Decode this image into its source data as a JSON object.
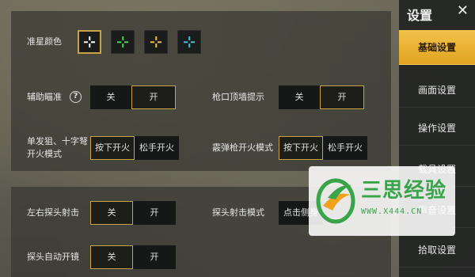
{
  "sidebar": {
    "title": "设置",
    "items": [
      {
        "label": "基础设置",
        "active": true
      },
      {
        "label": "画面设置",
        "active": false
      },
      {
        "label": "操作设置",
        "active": false
      },
      {
        "label": "载具设置",
        "active": false
      },
      {
        "label": "声音设置",
        "active": false
      },
      {
        "label": "拾取设置",
        "active": false
      }
    ]
  },
  "settings": {
    "crosshair_color": {
      "label": "准星颜色",
      "options": [
        {
          "color": "#ffffff",
          "selected": true
        },
        {
          "color": "#3fdc4b",
          "selected": false
        },
        {
          "color": "#f0c23a",
          "selected": false
        },
        {
          "color": "#3cc6d8",
          "selected": false
        }
      ]
    },
    "aim_assist": {
      "label": "辅助瞄准",
      "off": "关",
      "on": "开",
      "selected": "on"
    },
    "muzzle_wall_hint": {
      "label": "枪口顶墙提示",
      "off": "关",
      "on": "开",
      "selected": "on"
    },
    "single_shot_fire_mode": {
      "label_line1": "单发狙、十字弩",
      "label_line2": "开火模式",
      "press": "按下开火",
      "release": "松手开火",
      "selected": "press"
    },
    "shotgun_fire_mode": {
      "label": "霰弹枪开火模式",
      "press": "按下开火",
      "release": "松手开火",
      "selected": "press"
    },
    "lean_fire": {
      "label": "左右探头射击",
      "off": "关",
      "on": "开",
      "selected": "off"
    },
    "lean_fire_mode": {
      "label": "探头射击模式",
      "value": "点击侧身"
    },
    "lean_auto_scope": {
      "label": "探头自动开镜",
      "off": "关",
      "on": "开",
      "selected": "off"
    }
  },
  "watermark": {
    "brand": "三思经验",
    "url": "WWW.X444.CN"
  }
}
